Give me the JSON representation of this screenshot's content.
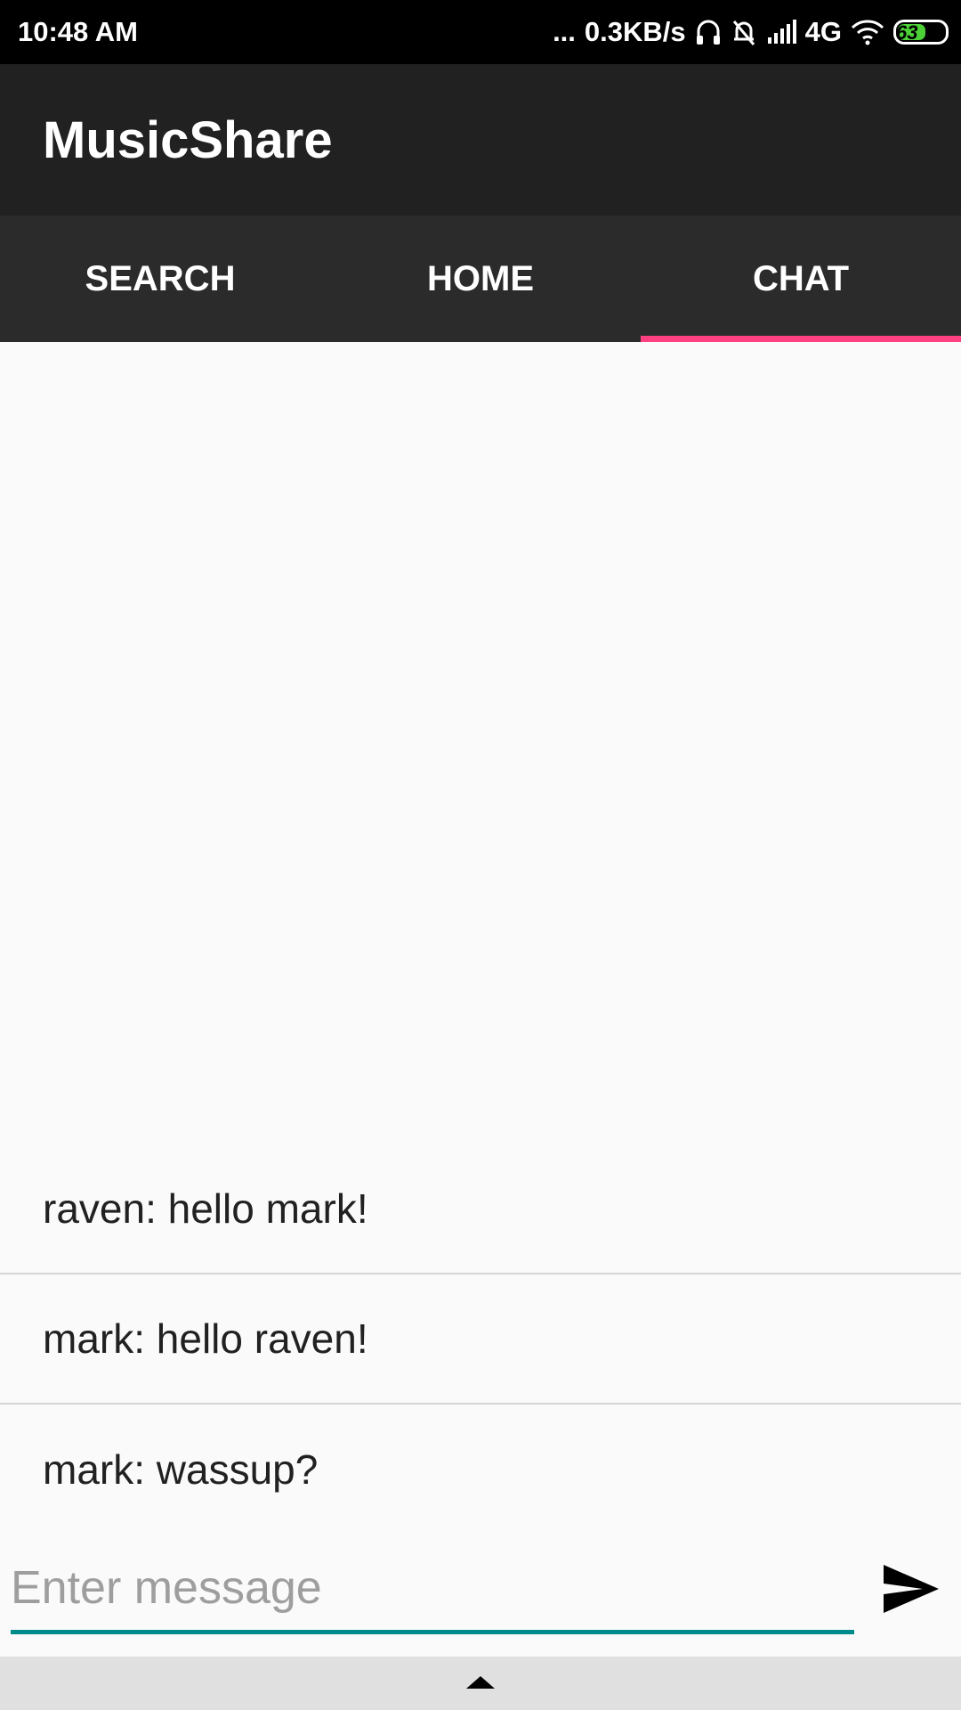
{
  "status_bar": {
    "time": "10:48 AM",
    "dots": "...",
    "speed": "0.3KB/s",
    "network": "4G",
    "battery_level": "63",
    "battery_fraction": 0.63,
    "icons": [
      "headphones-icon",
      "muted-bell-icon",
      "signal-icon",
      "wifi-icon",
      "battery-icon"
    ]
  },
  "app_bar": {
    "title": "MusicShare"
  },
  "tabs": [
    {
      "label": "SEARCH",
      "active": false
    },
    {
      "label": "HOME",
      "active": false
    },
    {
      "label": "CHAT",
      "active": true
    }
  ],
  "messages": [
    {
      "text": "raven: hello mark!"
    },
    {
      "text": "mark: hello raven!"
    },
    {
      "text": "mark: wassup?"
    }
  ],
  "input": {
    "value": "",
    "placeholder": "Enter message"
  },
  "colors": {
    "tab_indicator": "#ff4081",
    "input_underline": "#008b8b",
    "app_bar": "#212121",
    "tab_bar": "#2b2b2b"
  }
}
